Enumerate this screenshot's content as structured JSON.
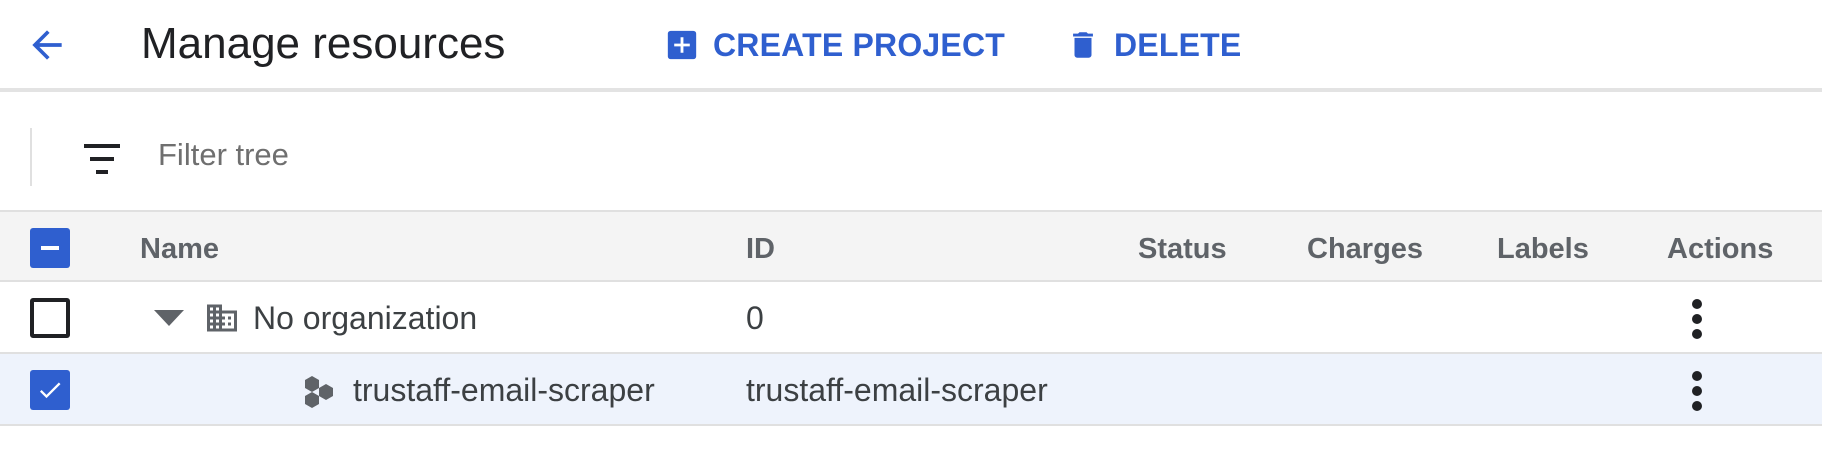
{
  "header": {
    "title": "Manage resources",
    "back_icon": "arrow-back-icon",
    "create_label": "CREATE PROJECT",
    "delete_label": "DELETE",
    "accent_color": "#2f5fcf"
  },
  "filter": {
    "placeholder": "Filter tree",
    "value": ""
  },
  "table": {
    "columns": [
      "Name",
      "ID",
      "Status",
      "Charges",
      "Labels",
      "Actions"
    ],
    "header_checkbox_state": "indeterminate",
    "rows": [
      {
        "name": "No organization",
        "id": "0",
        "type": "organization",
        "expanded": true,
        "checked": false,
        "icon": "building-icon"
      },
      {
        "name": "trustaff-email-scraper",
        "id": "trustaff-email-scraper",
        "type": "project",
        "checked": true,
        "icon": "project-hexagons-icon"
      }
    ]
  }
}
